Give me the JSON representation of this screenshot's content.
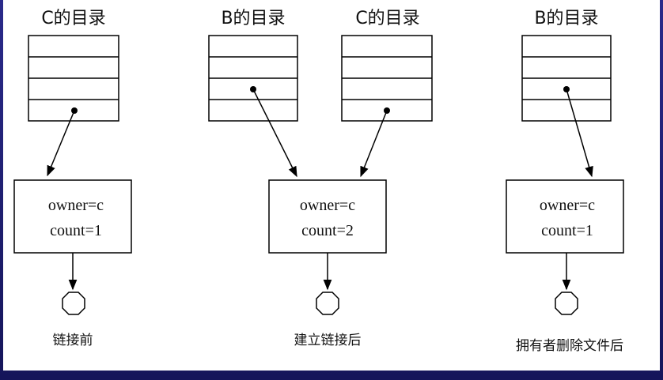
{
  "scenes": [
    {
      "directories": [
        {
          "title": "C的目录"
        }
      ],
      "node": {
        "owner": "owner=c",
        "count": "count=1"
      },
      "caption": "链接前"
    },
    {
      "directories": [
        {
          "title": "B的目录"
        },
        {
          "title": "C的目录"
        }
      ],
      "node": {
        "owner": "owner=c",
        "count": "count=2"
      },
      "caption": "建立链接后"
    },
    {
      "directories": [
        {
          "title": "B的目录"
        }
      ],
      "node": {
        "owner": "owner=c",
        "count": "count=1"
      },
      "caption": "拥有者删除文件后"
    }
  ]
}
